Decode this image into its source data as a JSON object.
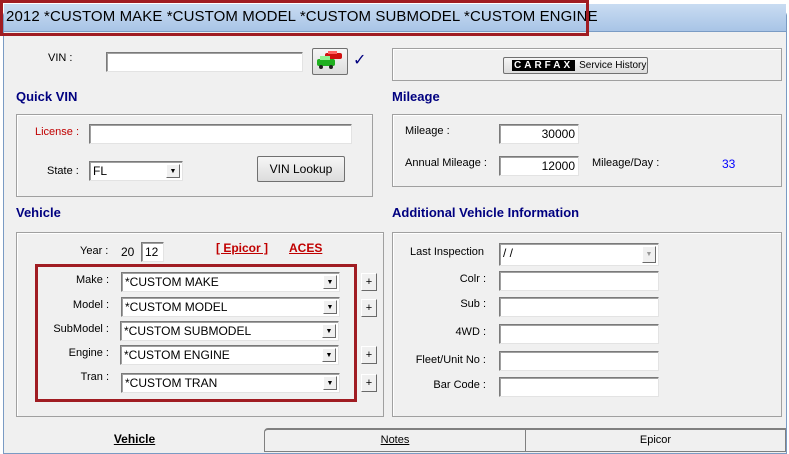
{
  "title": "2012 *CUSTOM MAKE *CUSTOM MODEL *CUSTOM SUBMODEL *CUSTOM ENGINE",
  "vin": {
    "label": "VIN :",
    "value": "",
    "check": "✓"
  },
  "carfax": {
    "logo": "CARFAX",
    "label": "Service History"
  },
  "quick_vin": {
    "heading": "Quick VIN",
    "license_label": "License :",
    "license_value": "",
    "state_label": "State :",
    "state_value": "FL",
    "lookup_button": "VIN Lookup"
  },
  "mileage": {
    "heading": "Mileage",
    "mileage_label": "Mileage :",
    "mileage_value": "30000",
    "annual_label": "Annual Mileage :",
    "annual_value": "12000",
    "per_day_label": "Mileage/Day :",
    "per_day_value": "33"
  },
  "vehicle": {
    "heading": "Vehicle",
    "year_label": "Year :",
    "year_prefix": "20",
    "year_value": "12",
    "epicor_link": "[ Epicor ]",
    "aces_link": "ACES",
    "rows": [
      {
        "label": "Make :",
        "value": "*CUSTOM MAKE",
        "plus": "+"
      },
      {
        "label": "Model :",
        "value": "*CUSTOM MODEL",
        "plus": "+"
      },
      {
        "label": "SubModel :",
        "value": "*CUSTOM SUBMODEL"
      },
      {
        "label": "Engine :",
        "value": "*CUSTOM ENGINE",
        "plus": "+"
      },
      {
        "label": "Tran :",
        "value": "*CUSTOM TRAN",
        "plus": "+"
      }
    ]
  },
  "additional": {
    "heading": "Additional Vehicle Information",
    "last_inspection_label": "Last Inspection",
    "last_inspection_value": " /  /",
    "fields": [
      {
        "label": "Colr :",
        "value": ""
      },
      {
        "label": "Sub :",
        "value": ""
      },
      {
        "label": "4WD :",
        "value": ""
      },
      {
        "label": "Fleet/Unit No :",
        "value": ""
      },
      {
        "label": "Bar Code :",
        "value": ""
      }
    ]
  },
  "tabs": [
    {
      "label": "Vehicle",
      "active": true
    },
    {
      "label": "Notes"
    },
    {
      "label": "Epicor"
    }
  ],
  "colors": {
    "accent": "#000080",
    "highlight": "#a01c22",
    "link": "#c00000",
    "value_blue": "#0000ff"
  }
}
